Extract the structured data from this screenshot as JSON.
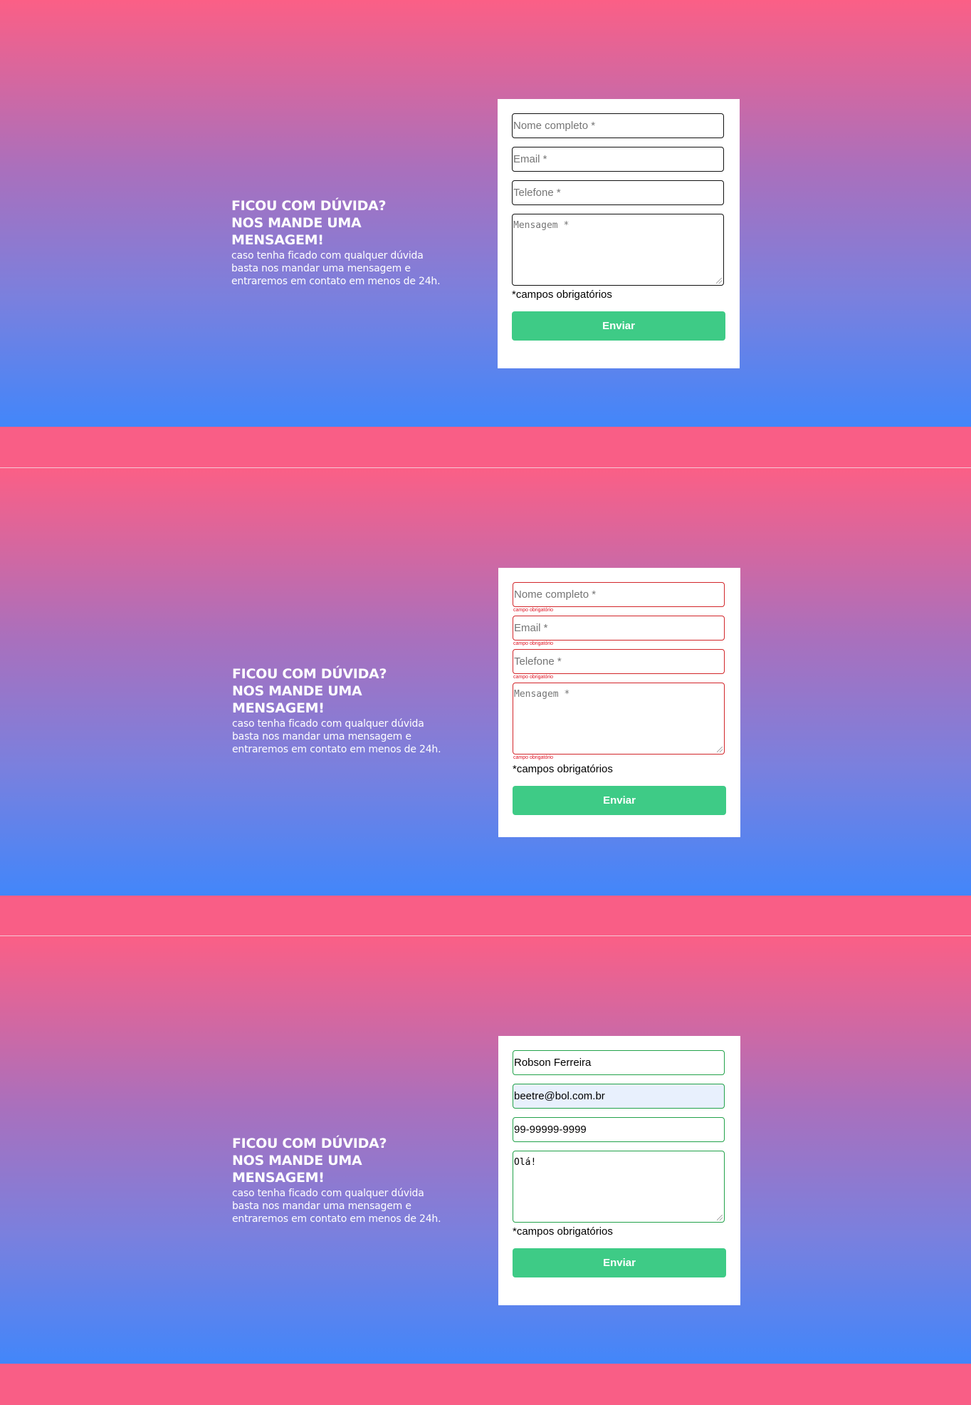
{
  "intro": {
    "title_line1": "FICOU COM DÚVIDA?",
    "title_line2": "NOS MANDE UMA MENSAGEM!",
    "body_line1": "caso tenha ficado com qualquer dúvida",
    "body_line2": "basta nos mandar uma mensagem e",
    "body_line3": "entraremos em contato em menos de 24h."
  },
  "form": {
    "name_placeholder": "Nome completo *",
    "email_placeholder": "Email *",
    "phone_placeholder": "Telefone *",
    "message_placeholder": "Mensagem *",
    "required_note": "*campos obrigatórios",
    "submit_label": "Enviar",
    "error_message": "campo obrigatório"
  },
  "states": {
    "default": "empty",
    "error": "validation-error",
    "filled": "valid"
  },
  "filled_values": {
    "name": "Robson Ferreira",
    "email": "beetre@bol.com.br",
    "phone": "99-99999-9999",
    "message": "Olá!"
  },
  "colors": {
    "gradient_top": "#fb5f86",
    "gradient_bottom": "#4286fa",
    "button": "#3ecb86",
    "error": "#d2262a",
    "valid": "#22a24a",
    "autofill": "#e8f0fd"
  }
}
